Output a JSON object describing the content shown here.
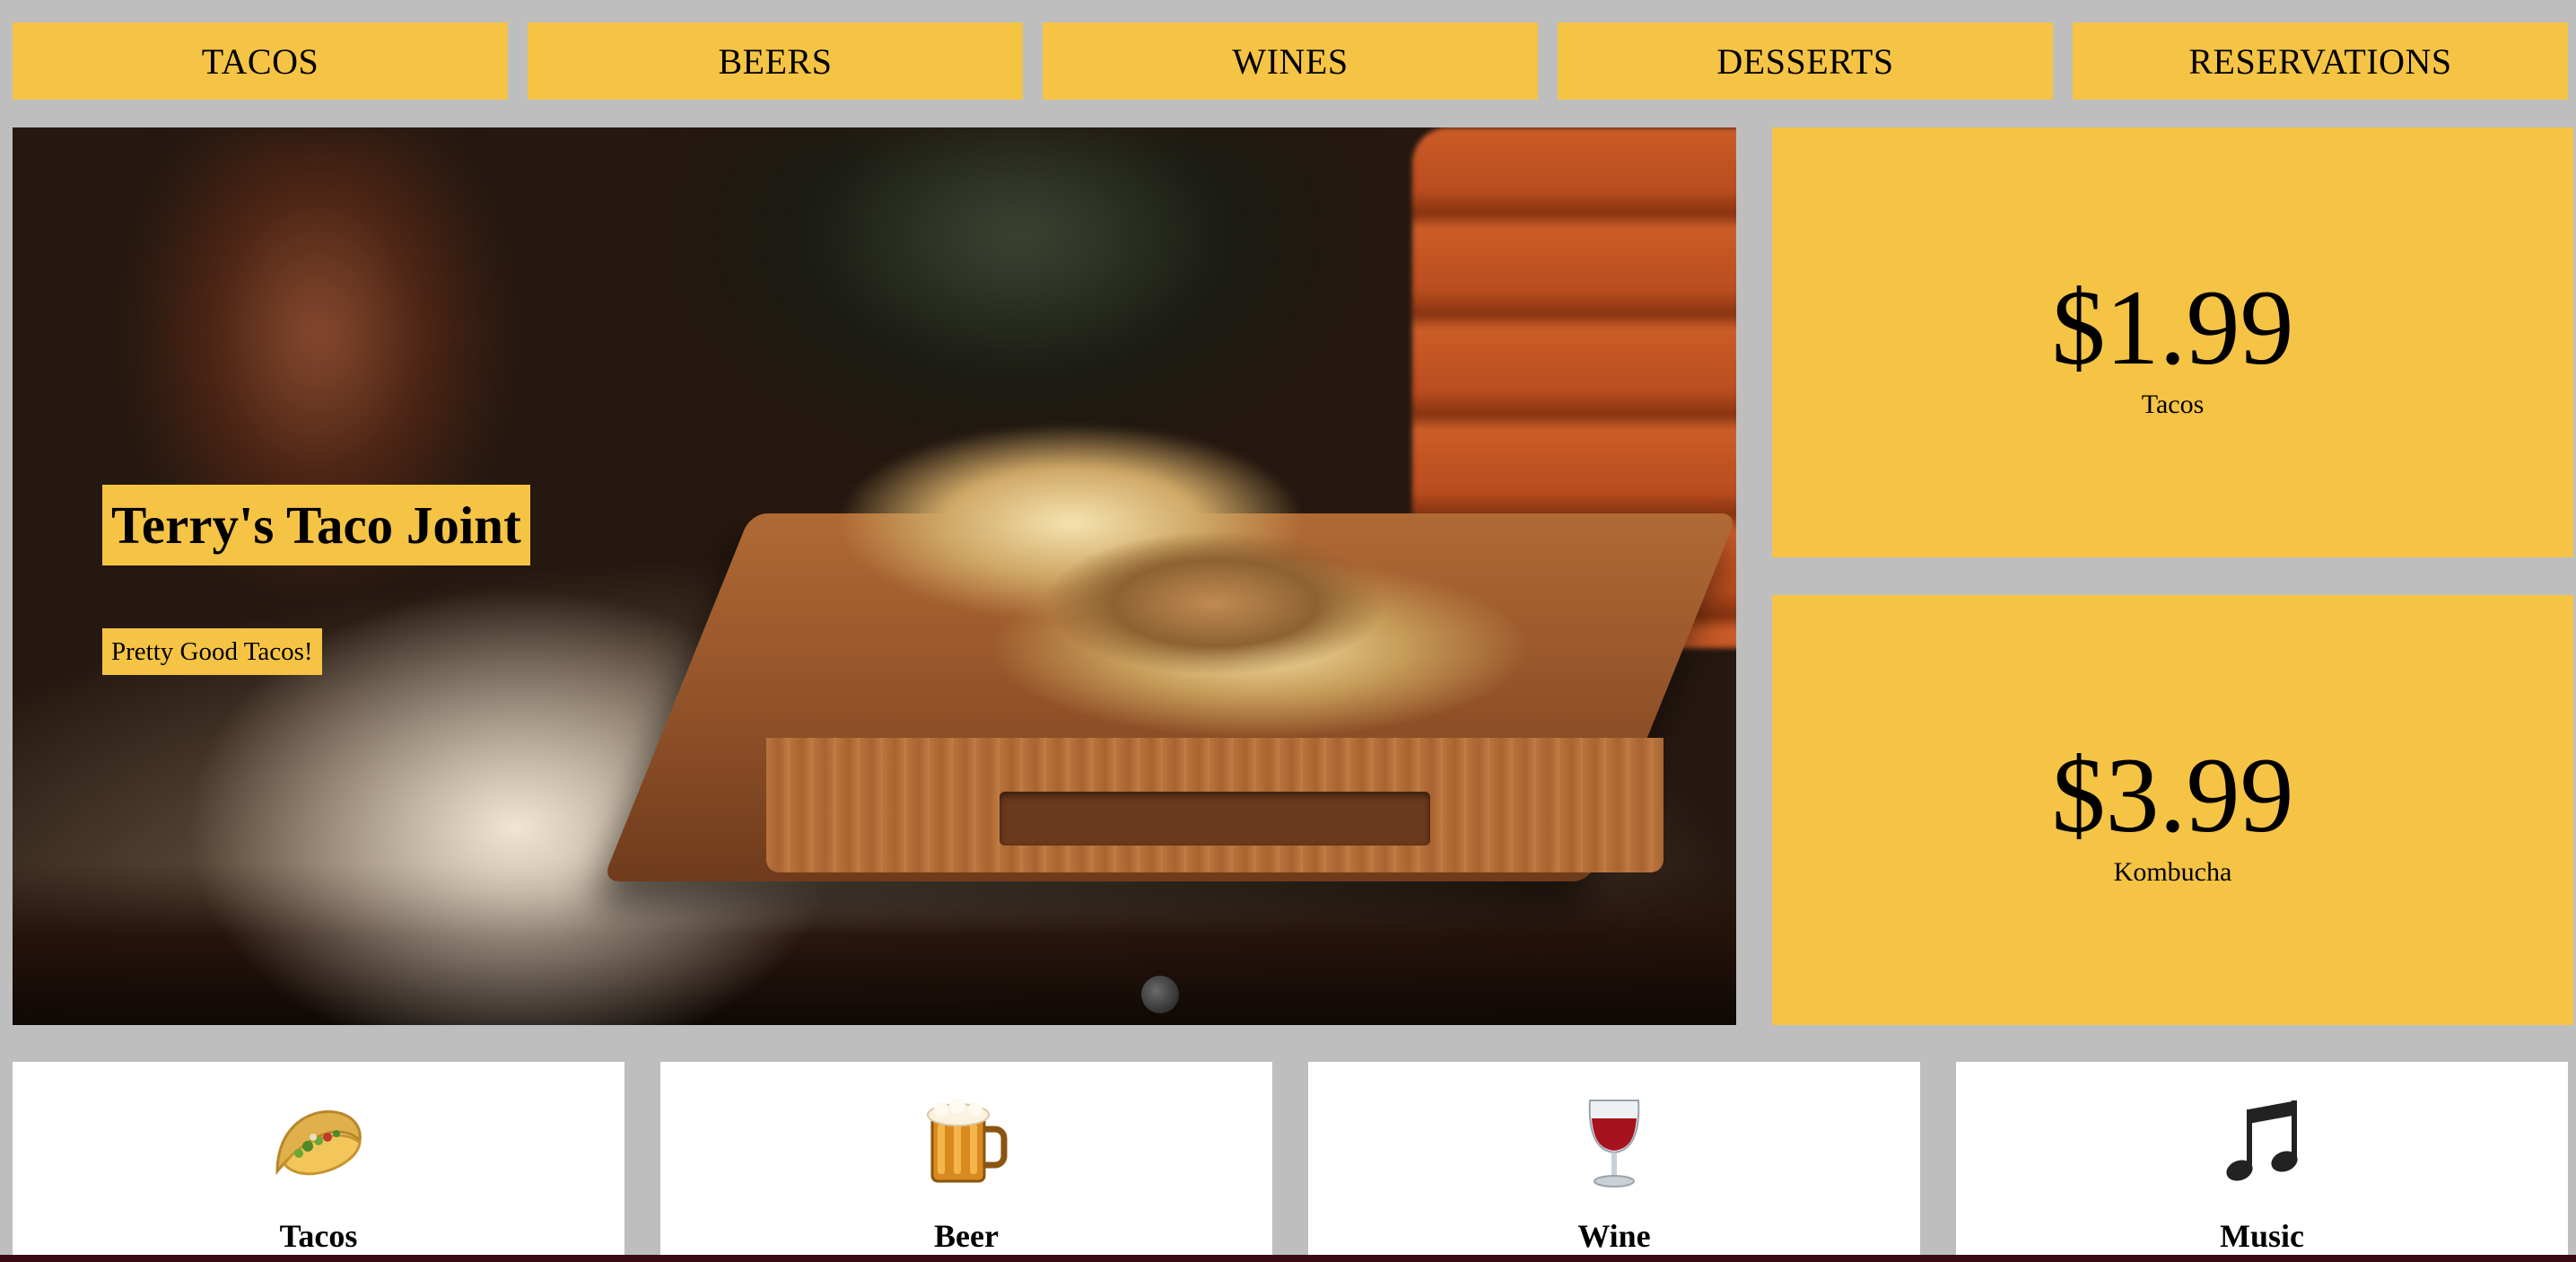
{
  "nav": {
    "items": [
      {
        "label": "TACOS"
      },
      {
        "label": "BEERS"
      },
      {
        "label": "WINES"
      },
      {
        "label": "DESSERTS"
      },
      {
        "label": "RESERVATIONS"
      }
    ]
  },
  "hero": {
    "title": "Terry's Taco Joint",
    "subtitle": "Pretty Good Tacos!"
  },
  "prices": [
    {
      "amount": "$1.99",
      "label": "Tacos"
    },
    {
      "amount": "$3.99",
      "label": "Kombucha"
    }
  ],
  "features": [
    {
      "icon": "taco-icon",
      "label": "Tacos"
    },
    {
      "icon": "beer-mug-icon",
      "label": "Beer"
    },
    {
      "icon": "wine-glass-icon",
      "label": "Wine"
    },
    {
      "icon": "music-notes-icon",
      "label": "Music"
    }
  ],
  "colors": {
    "accent": "#f5c445",
    "background": "#bebebe",
    "card": "#ffffff"
  }
}
